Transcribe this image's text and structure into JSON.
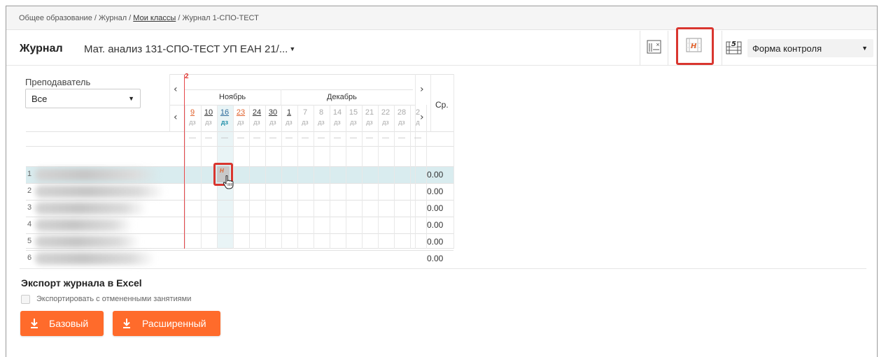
{
  "breadcrumb": {
    "part1": "Общее образование / Журнал / ",
    "link": "Мои классы",
    "part2": " / Журнал 1-СПО-ТЕСТ"
  },
  "header": {
    "title": "Журнал",
    "subject": "Мат. анализ 131-СПО-ТЕСТ УП ЕАН 21/...",
    "form_control": "Форма контроля"
  },
  "filter": {
    "teacher_label": "Преподаватель",
    "teacher_value": "Все"
  },
  "journal": {
    "marker": "2",
    "months": [
      {
        "name": "Ноябрь"
      },
      {
        "name": "Декабрь"
      }
    ],
    "days": [
      {
        "num": "9",
        "type": "дз",
        "style": "red"
      },
      {
        "num": "10",
        "type": "дз",
        "style": "ul"
      },
      {
        "num": "16",
        "type": "дз",
        "style": "sel"
      },
      {
        "num": "23",
        "type": "дз",
        "style": "red"
      },
      {
        "num": "24",
        "type": "дз",
        "style": "ul"
      },
      {
        "num": "30",
        "type": "дз",
        "style": "ul"
      },
      {
        "num": "1",
        "type": "дз",
        "style": "ul"
      },
      {
        "num": "7",
        "type": "дз",
        "style": "grey"
      },
      {
        "num": "8",
        "type": "дз",
        "style": "grey"
      },
      {
        "num": "14",
        "type": "дз",
        "style": "grey"
      },
      {
        "num": "15",
        "type": "дз",
        "style": "grey"
      },
      {
        "num": "21",
        "type": "дз",
        "style": "grey"
      },
      {
        "num": "22",
        "type": "дз",
        "style": "grey"
      },
      {
        "num": "28",
        "type": "дз",
        "style": "grey"
      },
      {
        "num": "2",
        "type": "д",
        "style": "grey"
      }
    ],
    "dash": "—",
    "avg_header": "Ср.",
    "rows": [
      {
        "num": "1",
        "avg": "0.00"
      },
      {
        "num": "2",
        "avg": "0.00"
      },
      {
        "num": "3",
        "avg": "0.00"
      },
      {
        "num": "4",
        "avg": "0.00"
      },
      {
        "num": "5",
        "avg": "0.00"
      },
      {
        "num": "6",
        "avg": "0.00"
      }
    ],
    "mark": "Н"
  },
  "export": {
    "title": "Экспорт журнала в Excel",
    "checkbox_label": "Экспортировать с отмененными занятиями",
    "basic_label": "Базовый",
    "extended_label": "Расширенный"
  },
  "colors": {
    "accent": "#ff6b2b",
    "highlight": "#d9362f",
    "selected_row": "#d9ecef"
  }
}
